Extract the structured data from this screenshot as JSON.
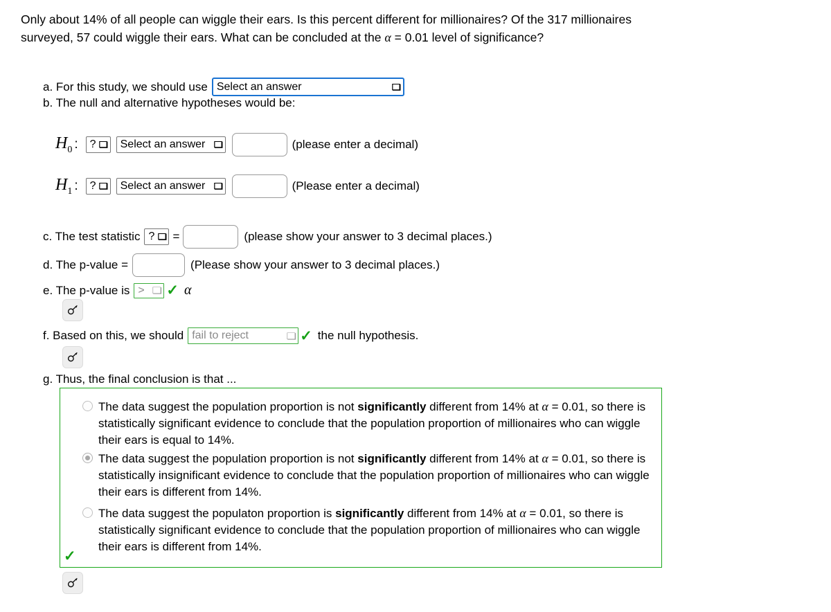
{
  "problem": {
    "text_a": "Only about 14% of all people can wiggle their ears. Is this percent different for millionaires? Of the 317 millionaires surveyed, 57 could wiggle their ears. What can be concluded at the ",
    "alpha_symbol": "α",
    "text_b": " = 0.01 level of significance?"
  },
  "parts": {
    "a": {
      "label": "a. For this study, we should use",
      "select_value": "Select an answer",
      "chevron": "⌄"
    },
    "b": {
      "label": "b. The null and alternative hypotheses would be:",
      "h0": {
        "symbol": "H",
        "subscript": "0",
        "colon": ":",
        "param_select": "?",
        "relation_select": "Select an answer",
        "value_input": "",
        "hint": "(please enter a decimal)"
      },
      "h1": {
        "symbol": "H",
        "subscript": "1",
        "colon": ":",
        "param_select": "?",
        "relation_select": "Select an answer",
        "value_input": "",
        "hint": "(Please enter a decimal)"
      }
    },
    "c": {
      "label": "c. The test statistic",
      "stat_select": "?",
      "equals": "=",
      "value_input": "",
      "hint": "(please show your answer to 3 decimal places.)"
    },
    "d": {
      "label": "d. The p-value =",
      "value_input": "",
      "hint": "(Please show your answer to 3 decimal places.)"
    },
    "e": {
      "label": "e. The p-value is",
      "comparison_select": ">",
      "alpha_symbol": "α",
      "check": "✓",
      "key_button": "key-icon"
    },
    "f": {
      "label_before": "f. Based on this, we should",
      "decision_select": "fail to reject",
      "check": "✓",
      "label_after": "the null hypothesis.",
      "key_button": "key-icon"
    },
    "g": {
      "label": "g. Thus, the final conclusion is that ...",
      "check": "✓",
      "key_button": "key-icon",
      "options": [
        {
          "selected": false,
          "seg1": "The data suggest the population proportion is not ",
          "bold": "significantly",
          "seg2": " different from 14% at ",
          "alpha": "α",
          "seg3": " = 0.01, so there is statistically significant evidence to conclude that the population proportion of millionaires who can wiggle their ears is equal to 14%."
        },
        {
          "selected": true,
          "seg1": "The data suggest the population proportion is not ",
          "bold": "significantly",
          "seg2": " different from 14% at ",
          "alpha": "α",
          "seg3": " = 0.01, so there is statistically insignificant evidence to conclude that the population proportion of millionaires who can wiggle their ears is different from 14%."
        },
        {
          "selected": false,
          "seg1": "The data suggest the populaton proportion is ",
          "bold": "significantly",
          "seg2": " different from 14% at ",
          "alpha": "α",
          "seg3": " = 0.01, so there is statistically significant evidence to conclude that the population proportion of millionaires who can wiggle their ears is different from 14%."
        }
      ]
    }
  },
  "colors": {
    "focus_blue": "#1a73d2",
    "valid_green": "#19a819",
    "check_green": "#16a116",
    "input_border": "#9a9a9a",
    "muted_text": "#8a8a8a"
  }
}
